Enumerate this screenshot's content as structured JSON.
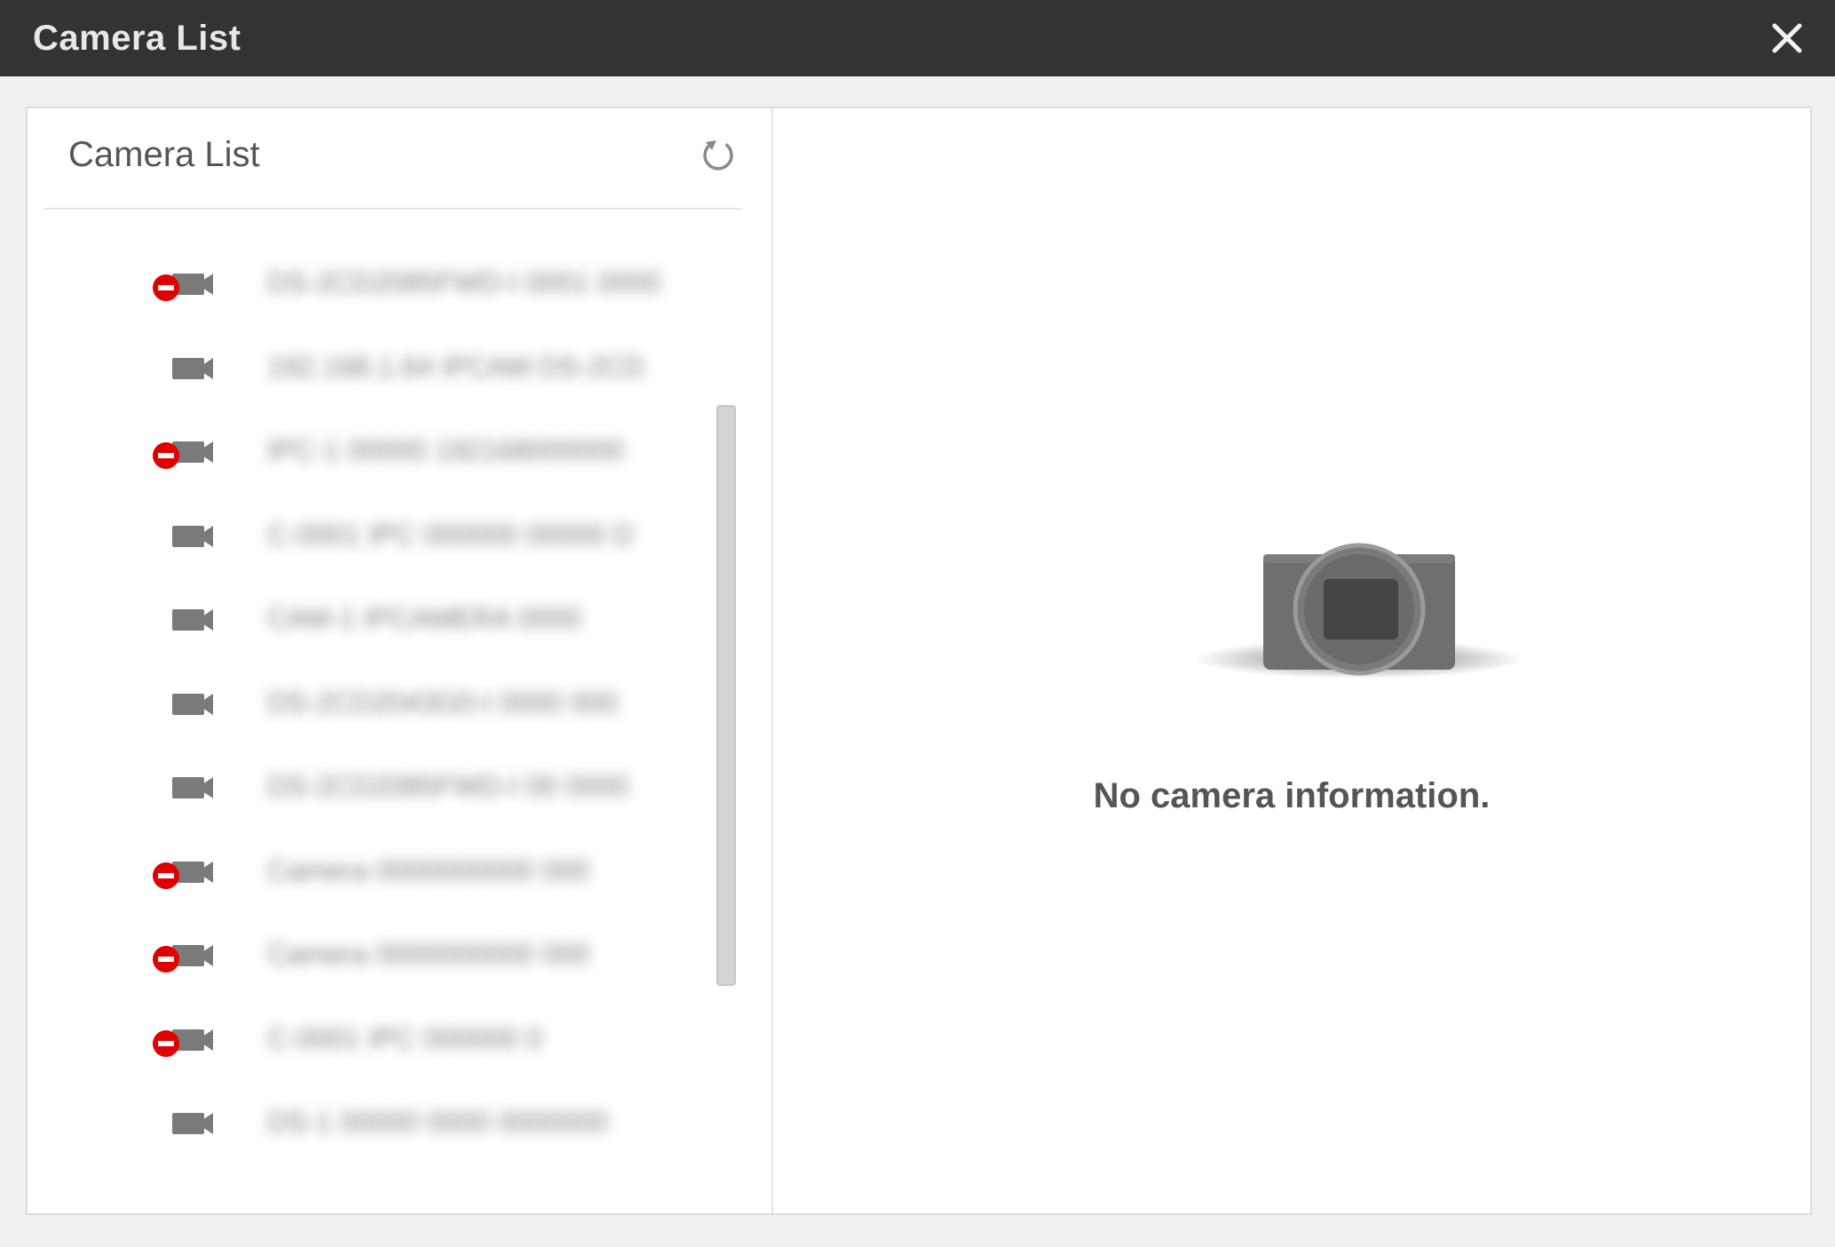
{
  "window": {
    "title": "Camera List"
  },
  "left_pane": {
    "title": "Camera List"
  },
  "cameras": [
    {
      "name": "DS-2CD2085FWD-I 0001 0000",
      "status": "offline"
    },
    {
      "name": "192.168.1.64 IPCAM DS-2CD",
      "status": "online"
    },
    {
      "name": "IPC-1 00000 192168000000",
      "status": "offline"
    },
    {
      "name": "C-0001 IPC 000000 00000 D",
      "status": "online"
    },
    {
      "name": "CAM-1 IPCAMERA 0000",
      "status": "online"
    },
    {
      "name": "DS-2CD2043G0-I 0000 000",
      "status": "online"
    },
    {
      "name": "DS-2CD2085FWD-I 00 0000",
      "status": "online"
    },
    {
      "name": "Camera 0000000000 000",
      "status": "offline"
    },
    {
      "name": "Camera 0000000000 000",
      "status": "offline"
    },
    {
      "name": "C-0001 IPC 000000 0",
      "status": "offline"
    },
    {
      "name": "DS-1 00000 0000 0000000",
      "status": "online"
    }
  ],
  "detail": {
    "empty_message": "No camera information."
  },
  "icons": {
    "close": "close-icon",
    "refresh": "refresh-icon",
    "camera": "video-camera-icon",
    "status_offline": "no-entry-icon",
    "placeholder": "camera-placeholder-icon"
  },
  "colors": {
    "titlebar": "#333333",
    "offline_badge": "#e00000",
    "camera_icon": "#7a7a7a"
  }
}
